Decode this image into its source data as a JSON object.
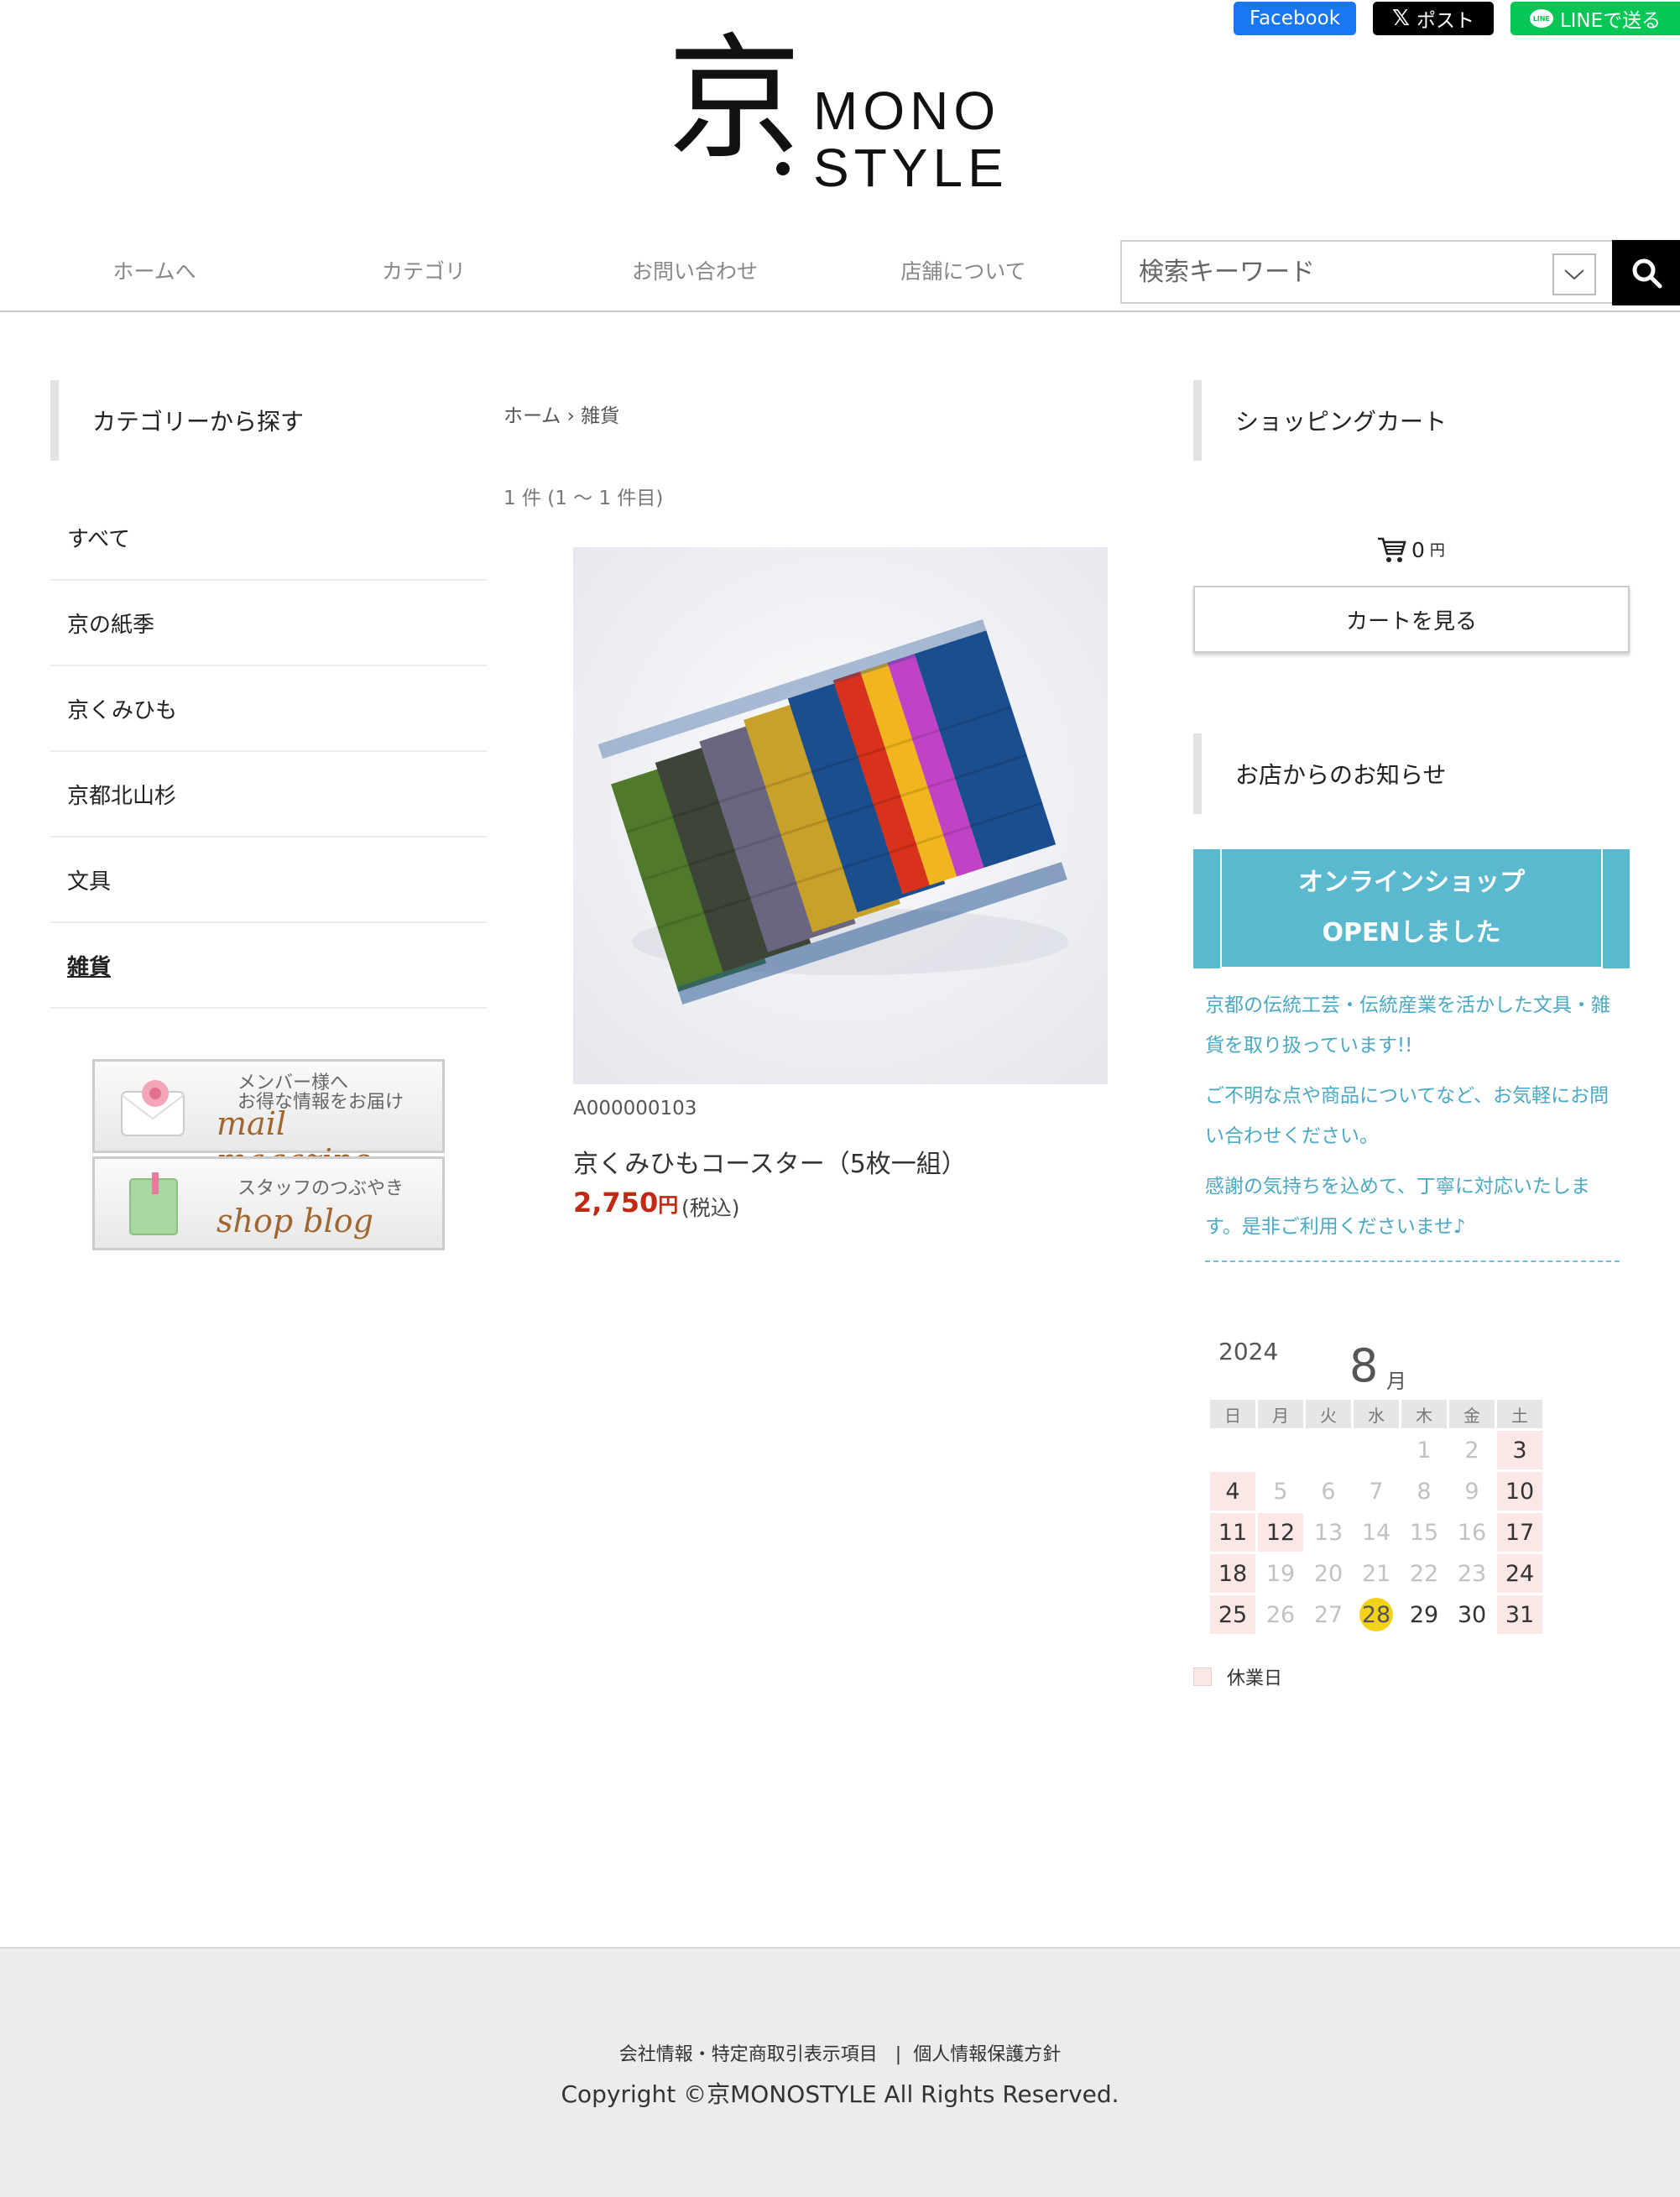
{
  "share": {
    "facebook": "Facebook",
    "x_post": "ポスト",
    "line": "LINEで送る",
    "line_bubble": "LINE"
  },
  "logo": {
    "kanji": "京",
    "line1": "MONO",
    "line2": "STYLE"
  },
  "nav": {
    "items": [
      "ホームへ",
      "カテゴリ",
      "お問い合わせ",
      "店舗について"
    ],
    "search_placeholder": "検索キーワード"
  },
  "left_sidebar": {
    "title": "カテゴリーから探す",
    "categories": [
      "すべて",
      "京の紙季",
      "京くみひも",
      "京都北山杉",
      "文具",
      "雑貨"
    ],
    "banners": [
      {
        "small_1": "メンバー様へ",
        "small_2": "お得な情報をお届け",
        "big": "mail magazine"
      },
      {
        "small_1": "スタッフのつぶやき",
        "small_2": "",
        "big": "shop blog"
      }
    ]
  },
  "main": {
    "breadcrumb": "ホーム › 雑貨",
    "count": "1 件 (1 〜 1 件目)",
    "product": {
      "sku": "A000000103",
      "name": "京くみひもコースター（5枚一組）",
      "price": "2,750",
      "currency": "円",
      "tax_note": "(税込)"
    }
  },
  "right_sidebar": {
    "cart_title": "ショッピングカート",
    "cart_total": "0",
    "cart_unit": "円",
    "cart_button": "カートを見る",
    "notice_title": "お店からのお知らせ",
    "notice_banner_line1": "オンラインショップ",
    "notice_banner_line2": "OPENしました",
    "notice_paragraphs": [
      "京都の伝統工芸・伝統産業を活かした文具・雑貨を取り扱っています!!",
      "ご不明な点や商品についてなど、お気軽にお問い合わせください。",
      "感謝の気持ちを込めて、丁寧に対応いたします。是非ご利用くださいませ♪"
    ]
  },
  "calendar": {
    "year": "2024",
    "month": "8",
    "month_suffix": "月",
    "weekdays": [
      "日",
      "月",
      "火",
      "水",
      "木",
      "金",
      "土"
    ],
    "weeks": [
      [
        "",
        "",
        "",
        "",
        "1",
        "2",
        "3"
      ],
      [
        "4",
        "5",
        "6",
        "7",
        "8",
        "9",
        "10"
      ],
      [
        "11",
        "12",
        "13",
        "14",
        "15",
        "16",
        "17"
      ],
      [
        "18",
        "19",
        "20",
        "21",
        "22",
        "23",
        "24"
      ],
      [
        "25",
        "26",
        "27",
        "28",
        "29",
        "30",
        "31"
      ]
    ],
    "closed_days": [
      "3",
      "4",
      "10",
      "11",
      "12",
      "17",
      "18",
      "24",
      "25",
      "31"
    ],
    "today": "28",
    "legend": "休業日",
    "colors": {
      "closed": "#fbe8e6",
      "today": "#f4d21c"
    }
  },
  "footer": {
    "links": [
      "会社情報・特定商取引表示項目",
      "個人情報保護方針"
    ],
    "separator": "|",
    "copyright": "Copyright ©京MONOSTYLE All Rights Reserved."
  },
  "colors": {
    "facebook": "#1877f2",
    "x": "#000000",
    "line": "#06c755",
    "price": "#c02a12",
    "notice_banner": "#5ab8cf",
    "notice_text": "#4aa9c4"
  }
}
